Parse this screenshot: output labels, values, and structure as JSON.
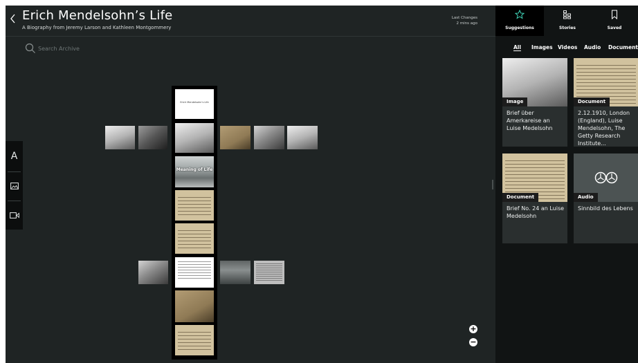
{
  "header": {
    "title": "Erich Mendelsohn’s Life",
    "subtitle": "A Biography from Jeremy Larson and Kathleen Montgommery",
    "last_changes_label": "Last Changes",
    "last_changes_value": "2 mins ago"
  },
  "search": {
    "placeholder": "Search Archive",
    "value": ""
  },
  "left_tools": {
    "text_label": "A",
    "icons": [
      "text-tool",
      "image-icon",
      "video-camera-icon"
    ]
  },
  "canvas": {
    "title_tile_caption": "Erich Mendelsohn’s Life",
    "overlay_tile_caption": "Meaning of Life"
  },
  "panel": {
    "tabs": [
      {
        "label": "Suggestions",
        "icon": "star-icon",
        "active": true
      },
      {
        "label": "Stories",
        "icon": "grid-icon",
        "active": false
      },
      {
        "label": "Saved",
        "icon": "bookmark-icon",
        "active": false
      }
    ],
    "filters": [
      "All",
      "Images",
      "Videos",
      "Audio",
      "Documents"
    ],
    "active_filter": "All",
    "cards": [
      {
        "type": "Image",
        "title": "Brief über Amerkareise an Luise Medelsohn"
      },
      {
        "type": "Document",
        "title": "2.12.1910, London (England), Luise Mendelsohn, The Getty Research Institute..."
      },
      {
        "type": "Document",
        "title": "Brief No. 24 an Luise Medelsohn"
      },
      {
        "type": "Audio",
        "title": "Sinnbild des Lebens"
      }
    ]
  },
  "zoom": {
    "in_label": "+",
    "out_label": "−"
  },
  "colors": {
    "accent": "#3fd1b5",
    "panel_bg": "#111414",
    "canvas_bg": "#1f2424"
  }
}
